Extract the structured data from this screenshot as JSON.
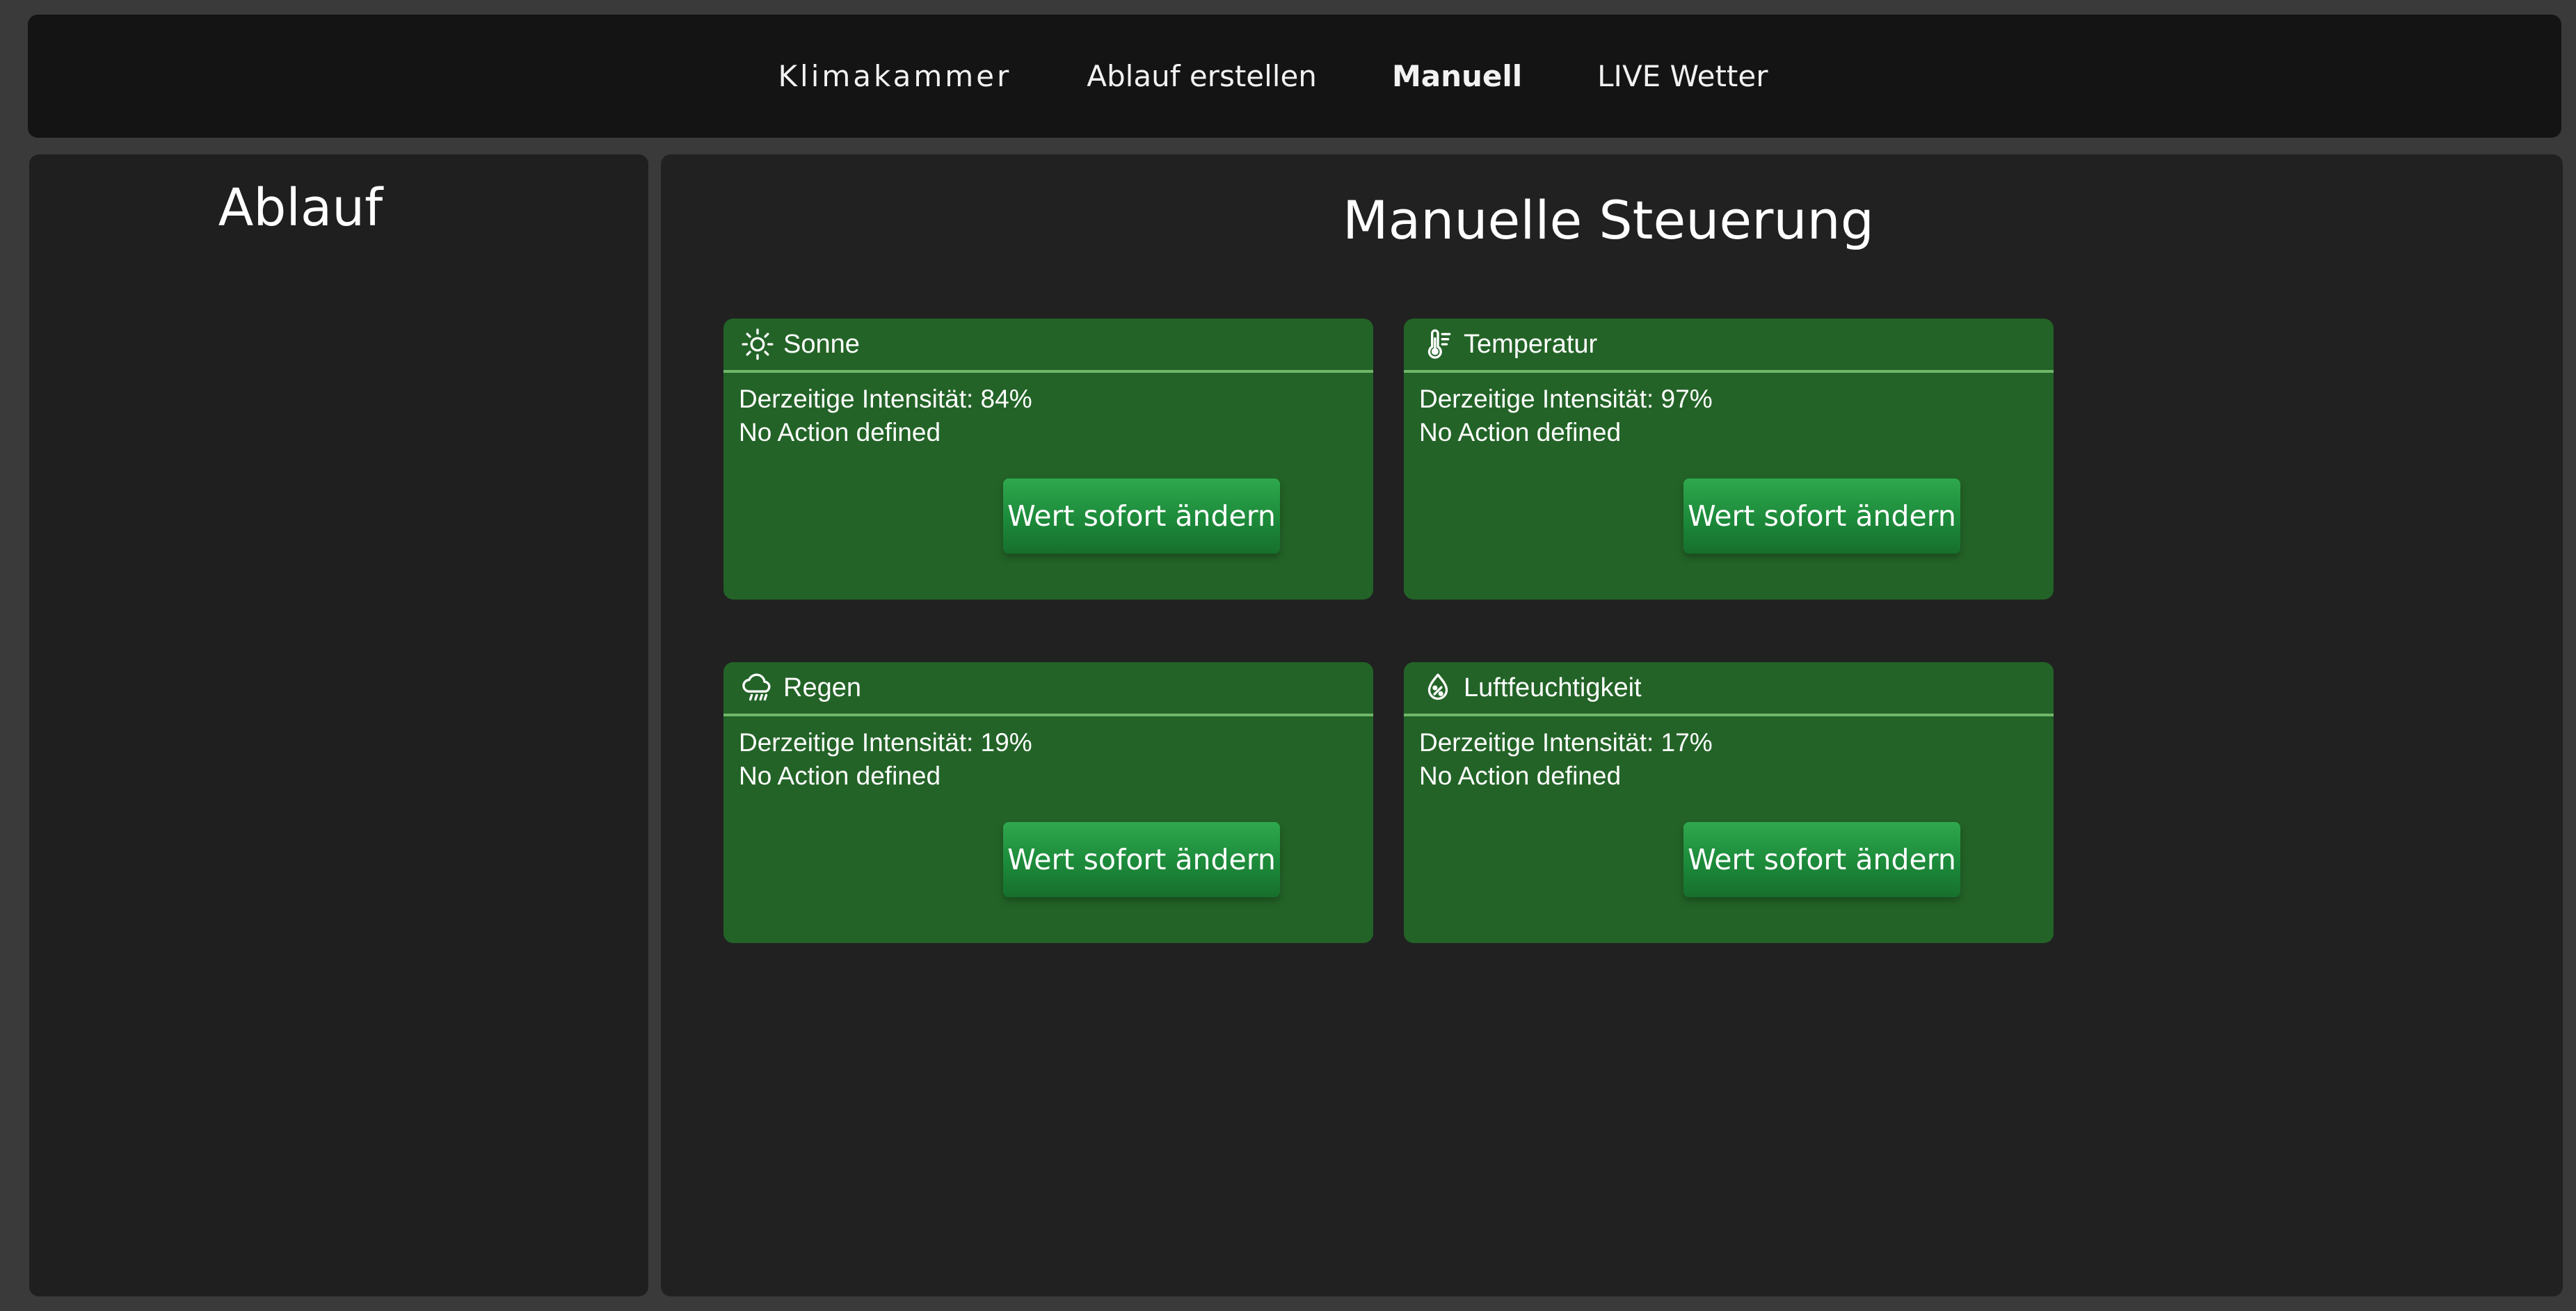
{
  "nav": {
    "items": [
      {
        "label": "Klimakammer"
      },
      {
        "label": "Ablauf erstellen"
      },
      {
        "label": "Manuell"
      },
      {
        "label": "LIVE Wetter"
      }
    ],
    "active": "Manuell"
  },
  "sidebar": {
    "title": "Ablauf"
  },
  "main": {
    "title": "Manuelle Steuerung",
    "cards": [
      {
        "icon": "sun-icon",
        "title": "Sonne",
        "intensity": "Derzeitige Intensität: 84%",
        "action": "No Action defined",
        "button": "Wert sofort ändern"
      },
      {
        "icon": "thermometer-icon",
        "title": "Temperatur",
        "intensity": "Derzeitige Intensität: 97%",
        "action": "No Action defined",
        "button": "Wert sofort ändern"
      },
      {
        "icon": "cloud-rain-icon",
        "title": "Regen",
        "intensity": "Derzeitige Intensität: 19%",
        "action": "No Action defined",
        "button": "Wert sofort ändern"
      },
      {
        "icon": "humidity-drop-icon",
        "title": "Luftfeuchtigkeit",
        "intensity": "Derzeitige Intensität: 17%",
        "action": "No Action defined",
        "button": "Wert sofort ändern"
      }
    ]
  },
  "colors": {
    "background": "#3a3a3a",
    "navbar": "#141414",
    "panel": "#1f1f1f",
    "card": "#236327",
    "card_divider": "#6fb86a",
    "button": "#1c8a3a"
  }
}
